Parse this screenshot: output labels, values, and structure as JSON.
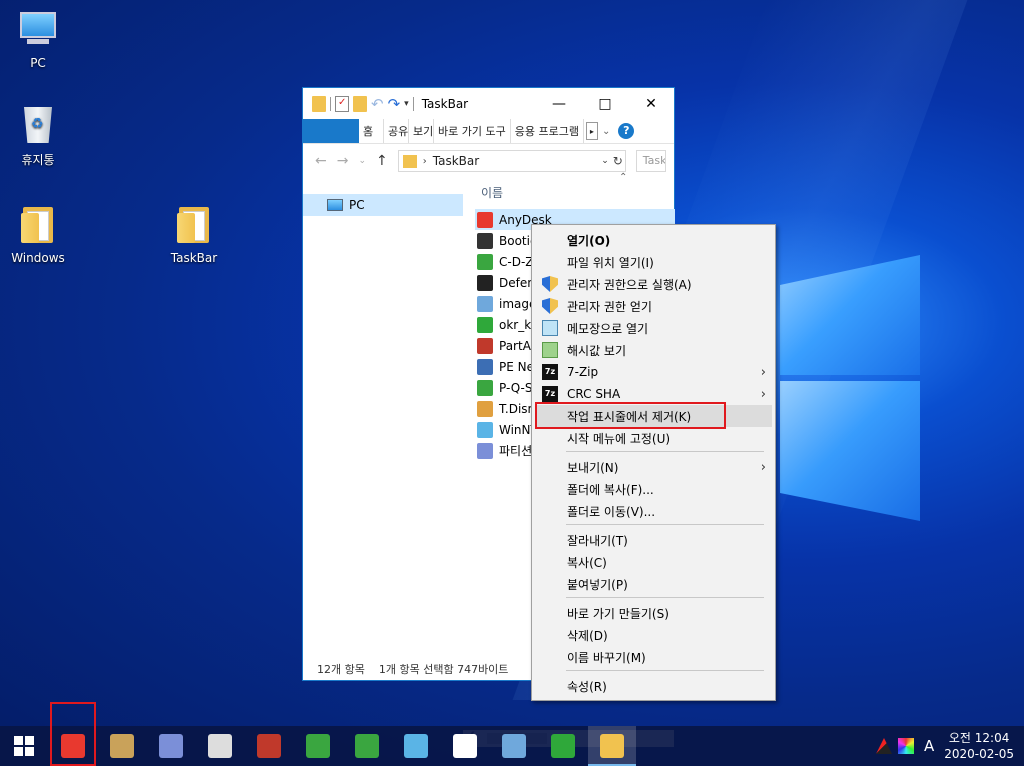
{
  "desktop": {
    "icons": [
      {
        "label": "PC"
      },
      {
        "label": "휴지통"
      },
      {
        "label": "Windows"
      },
      {
        "label": "TaskBar"
      }
    ]
  },
  "explorer": {
    "title": "TaskBar",
    "ribbon_tabs": [
      "홈",
      "공유",
      "보기",
      "바로 가기 도구",
      "응용 프로그램"
    ],
    "address_crumb": "TaskBar",
    "search_placeholder": "TaskBar 검색",
    "nav_items": [
      {
        "label": "PC"
      }
    ],
    "column_header": "이름",
    "files": [
      {
        "name": "AnyDesk",
        "icon_color": "#e8392f",
        "selected": true
      },
      {
        "name": "Bootice",
        "icon_color": "#333333"
      },
      {
        "name": "C-D-Z",
        "icon_color": "#3aa640"
      },
      {
        "name": "Defender",
        "icon_color": "#222222"
      },
      {
        "name": "imagex",
        "icon_color": "#6fa8dc"
      },
      {
        "name": "okr_kill",
        "icon_color": "#2fa83a"
      },
      {
        "name": "PartAssist",
        "icon_color": "#c0392b"
      },
      {
        "name": "PE Network",
        "icon_color": "#3c6eb4"
      },
      {
        "name": "P-Q-S",
        "icon_color": "#3aa640"
      },
      {
        "name": "T.Dism",
        "icon_color": "#e0a040"
      },
      {
        "name": "WinNTSetup",
        "icon_color": "#5ab4e6"
      },
      {
        "name": "파티션",
        "icon_color": "#7b8fd8"
      }
    ],
    "status": {
      "count": "12개 항목",
      "selected": "1개 항목 선택함 747바이트"
    }
  },
  "context_menu": {
    "items": [
      {
        "label": "열기(O)",
        "bold": true
      },
      {
        "label": "파일 위치 열기(I)"
      },
      {
        "label": "관리자 권한으로 실행(A)",
        "icon": "uac-shield-icon"
      },
      {
        "label": "관리자 권한 얻기",
        "icon": "uac-shield-icon"
      },
      {
        "label": "메모장으로 열기",
        "icon": "notepad-icon"
      },
      {
        "label": "해시값 보기",
        "icon": "hash-icon"
      },
      {
        "label": "7-Zip",
        "icon": "7zip-icon",
        "submenu": true
      },
      {
        "label": "CRC SHA",
        "icon": "7zip-icon",
        "submenu": true
      },
      {
        "label": "작업 표시줄에서 제거(K)",
        "highlighted": true
      },
      {
        "label": "시작 메뉴에 고정(U)"
      },
      {
        "label": "보내기(N)",
        "submenu": true
      },
      {
        "label": "폴더에 복사(F)..."
      },
      {
        "label": "폴더로 이동(V)..."
      },
      {
        "label": "잘라내기(T)"
      },
      {
        "label": "복사(C)"
      },
      {
        "label": "붙여넣기(P)"
      },
      {
        "label": "바로 가기 만들기(S)"
      },
      {
        "label": "삭제(D)"
      },
      {
        "label": "이름 바꾸기(M)"
      },
      {
        "label": "속성(R)"
      }
    ]
  },
  "taskbar": {
    "apps": [
      {
        "name": "start-button"
      },
      {
        "name": "anydesk",
        "color": "#e8392f"
      },
      {
        "name": "bootice",
        "color": "#c9a25a"
      },
      {
        "name": "partition",
        "color": "#7b8fd8"
      },
      {
        "name": "defender",
        "color": "#dddddd"
      },
      {
        "name": "partassist",
        "color": "#c0392b"
      },
      {
        "name": "c-d-z",
        "color": "#3aa640"
      },
      {
        "name": "p-q-s",
        "color": "#3aa640"
      },
      {
        "name": "winntsetup",
        "color": "#5ab4e6"
      },
      {
        "name": "defender-shield",
        "color": "#ffffff"
      },
      {
        "name": "imagex",
        "color": "#6fa8dc"
      },
      {
        "name": "okr-kill",
        "color": "#2fa83a"
      },
      {
        "name": "file-explorer",
        "color": "#f1c24f"
      }
    ],
    "ime": "A",
    "clock_time": "오전 12:04",
    "clock_date": "2020-02-05"
  }
}
